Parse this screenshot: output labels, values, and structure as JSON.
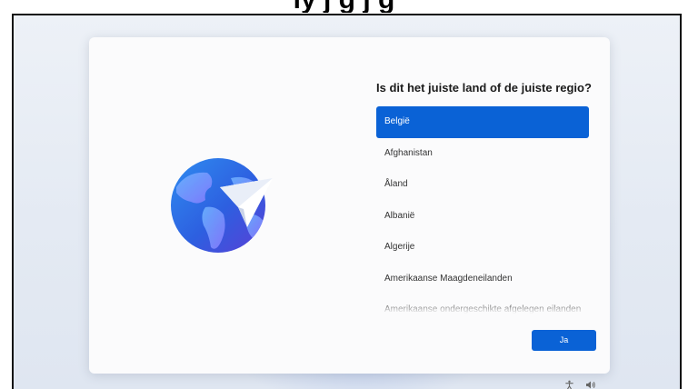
{
  "top_caption": "ly                    j             g             j           g",
  "card": {
    "title": "Is dit het juiste land of de juiste regio?",
    "illustration": "globe-with-paper-plane-icon"
  },
  "region_list": {
    "selected": "België",
    "items": [
      {
        "label": "België",
        "selected": true
      },
      {
        "label": "Afghanistan",
        "selected": false
      },
      {
        "label": "Åland",
        "selected": false
      },
      {
        "label": "Albanië",
        "selected": false
      },
      {
        "label": "Algerije",
        "selected": false
      },
      {
        "label": "Amerikaanse Maagdeneilanden",
        "selected": false
      },
      {
        "label": "Amerikaanse ondergeschikte afgelegen eilanden",
        "selected": false
      }
    ]
  },
  "confirm_button": {
    "label": "Ja"
  },
  "taskbar": {
    "icons": [
      "accessibility-icon",
      "volume-icon"
    ]
  },
  "colors": {
    "accent": "#0a62d6",
    "card_background": "#fbfbfc",
    "desktop_background": "#e6ecf4"
  }
}
